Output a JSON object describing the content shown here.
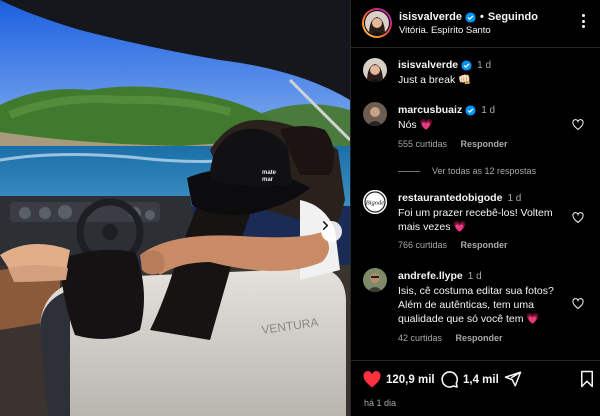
{
  "post": {
    "username": "isisvalverde",
    "follow_status": "Seguindo",
    "location": "Vitória. Espírito Santo",
    "caption": "Just a break 👊🏻",
    "caption_time": "1 d",
    "likes": "120,9 mil",
    "comments_count": "1,4 mil",
    "date": "há 1 dia"
  },
  "comments": [
    {
      "username": "marcusbuaiz",
      "verified": true,
      "time": "1 d",
      "text": "Nós 💗",
      "likes": "555 curtidas",
      "reply_label": "Responder",
      "view_replies": "Ver todas as 12 respostas"
    },
    {
      "username": "restaurantedobigode",
      "verified": false,
      "time": "1 d",
      "text": "Foi um prazer recebê-los! Voltem mais vezes 💗",
      "likes": "766 curtidas",
      "reply_label": "Responder",
      "avatar_text": "Bigode"
    },
    {
      "username": "andrefe.llype",
      "verified": false,
      "time": "1 d",
      "text": "Isis, cê costuma editar sua fotos? Além de autênticas, tem uma qualidade que só você tem 💗",
      "likes": "42 curtidas",
      "reply_label": "Responder"
    }
  ],
  "photo": {
    "hat_text": "mate\nmar",
    "seat_text": "VENTURA"
  },
  "icons": {
    "more": "more-options-icon",
    "verified": "verified-badge-icon",
    "heart": "heart-icon",
    "comment": "comment-icon",
    "share": "share-icon",
    "save": "bookmark-icon",
    "next": "chevron-right-icon"
  },
  "colors": {
    "like_red": "#ff3040",
    "verified_blue": "#0095f6",
    "secondary_text": "#a8a8a8"
  }
}
